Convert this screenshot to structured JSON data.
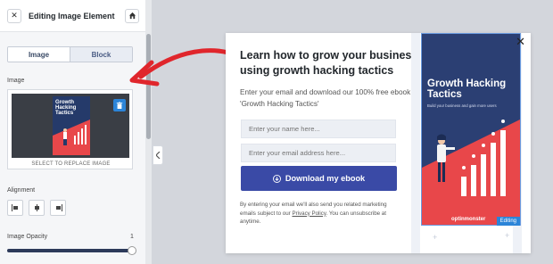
{
  "sidebar": {
    "title": "Editing Image Element",
    "close_icon": "close-icon",
    "home_icon": "home-icon",
    "tabs": [
      {
        "label": "Image",
        "active": true
      },
      {
        "label": "Block",
        "active": false
      }
    ],
    "image_label": "Image",
    "thumb_title": "Growth Hacking Tactics",
    "replace_text": "SELECT TO REPLACE IMAGE",
    "alignment_label": "Alignment",
    "opacity_label": "Image Opacity",
    "opacity_value": "1"
  },
  "popup": {
    "headline": "Learn how to grow your business using growth hacking tactics",
    "subtext": "Enter your email and download our 100% free ebook 'Growth Hacking Tactics'",
    "name_placeholder": "Enter your name here...",
    "email_placeholder": "Enter your email address here...",
    "button_label": "Download my ebook",
    "legal_before": "By entering your email we'll also send you related marketing emails subject to our ",
    "legal_link": "Privacy Policy",
    "legal_after": ". You can unsubscribe at anytime.",
    "close_glyph": "✕",
    "cover": {
      "title_line1": "Growth Hacking",
      "title_line2": "Tactics",
      "tagline": "Build your business and gain more users",
      "brand": "optinmonster",
      "editing_badge": "Editing"
    }
  },
  "colors": {
    "accent_blue": "#2b84d8",
    "button_navy": "#3a4aa6",
    "cover_navy": "#2b3f73",
    "cover_red": "#e8474a",
    "arrow_red": "#e0262c"
  }
}
